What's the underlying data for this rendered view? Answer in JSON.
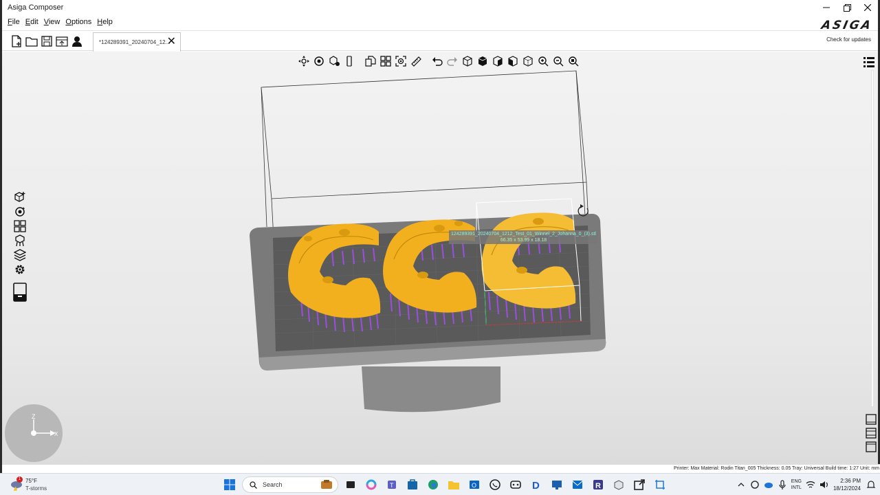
{
  "window": {
    "title": "Asiga Composer",
    "logo_text": "ASIGA"
  },
  "menu": [
    {
      "label": "File",
      "key": "F",
      "rest": "ile"
    },
    {
      "label": "Edit",
      "key": "E",
      "rest": "dit"
    },
    {
      "label": "View",
      "key": "V",
      "rest": "iew"
    },
    {
      "label": "Options",
      "key": "O",
      "rest": "ptions"
    },
    {
      "label": "Help",
      "key": "H",
      "rest": "elp"
    }
  ],
  "document_tab": {
    "label": "*124289391_20240704_12...",
    "close_glyph": "✕"
  },
  "check_updates_label": "Check for updates",
  "file_toolbar_icons": [
    "new-file-icon",
    "open-folder-icon",
    "save-icon",
    "save-as-icon",
    "user-icon"
  ],
  "viewport_toolbar_icons": [
    "move-icon",
    "rotate-icon",
    "add-supports-icon",
    "mirror-icon",
    "duplicate-icon",
    "arrange-icon",
    "select-all-icon",
    "measure-icon",
    "undo-icon",
    "redo-icon",
    "view-front-icon",
    "view-top-icon",
    "view-side-icon",
    "view-iso-icon",
    "view-back-icon",
    "zoom-in-icon",
    "zoom-out-icon",
    "zoom-fit-icon"
  ],
  "left_toolbar_icons": [
    "add-part-icon",
    "orient-icon",
    "layout-grid-icon",
    "supports-icon",
    "slice-layers-icon",
    "settings-icon",
    "printer-icon"
  ],
  "selected_part_tooltip": {
    "name": "124289391_20240704_1212_Test_01_Winnel_2_Johanna_0_(3).stl",
    "dimensions": "66.35 x 53.99 x 18.18"
  },
  "status_bar": {
    "text": "Printer: Max  Material: Rodin Titan_005  Thickness: 0.05  Tray: Universal  Build time: 1:27  Unit: mm"
  },
  "taskbar": {
    "weather_temp": "75°F",
    "weather_condition": "T-storms",
    "weather_badge": "1",
    "search_placeholder": "Search",
    "language_line1": "ENG",
    "language_line2": "INTL",
    "time": "2:36 PM",
    "date": "18/12/2024"
  },
  "colors": {
    "model": "#f2b01e",
    "supports": "#9b4fe0",
    "platform": "#7b7b7b",
    "selection": "#ffffff"
  }
}
